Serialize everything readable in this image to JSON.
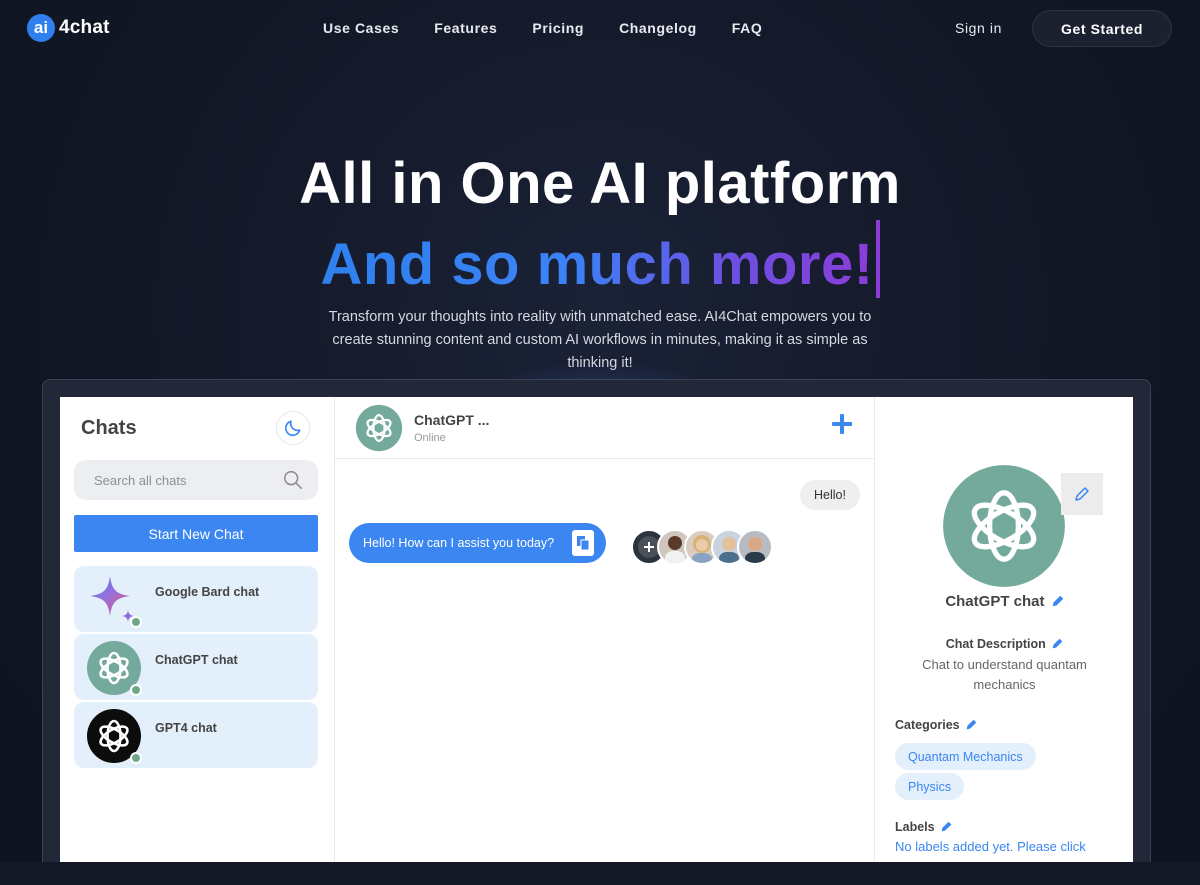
{
  "nav": {
    "logo_badge": "ai",
    "logo_text": "4chat",
    "links": [
      "Use Cases",
      "Features",
      "Pricing",
      "Changelog",
      "FAQ"
    ],
    "signin": "Sign in",
    "get_started": "Get Started"
  },
  "hero": {
    "title": "All in One AI platform",
    "subtitle": "And so much more!",
    "description": "Transform your thoughts into reality with unmatched ease. AI4Chat empowers you to create stunning content and custom AI workflows in minutes, making it as simple as thinking it!"
  },
  "app": {
    "sidebar": {
      "title": "Chats",
      "search_placeholder": "Search all chats",
      "new_chat": "Start New Chat",
      "items": [
        {
          "name": "Google Bard chat",
          "icon": "gemini-sparkle-icon"
        },
        {
          "name": "ChatGPT chat",
          "icon": "openai-logo-icon"
        },
        {
          "name": "GPT4 chat",
          "icon": "openai-logo-icon"
        }
      ]
    },
    "chat": {
      "header_name": "ChatGPT ...",
      "header_status": "Online",
      "user_message": "Hello!",
      "bot_message": "Hello! How can I assist you today?"
    },
    "details": {
      "name": "ChatGPT chat",
      "description_title": "Chat Description",
      "description": "Chat to understand quantam mechanics",
      "categories_title": "Categories",
      "categories": [
        "Quantam Mechanics",
        "Physics"
      ],
      "labels_title": "Labels",
      "labels_text": "No labels added yet. Please click"
    }
  },
  "colors": {
    "accent": "#3b86f0",
    "openai_green": "#74aa9c",
    "background": "#121726"
  }
}
